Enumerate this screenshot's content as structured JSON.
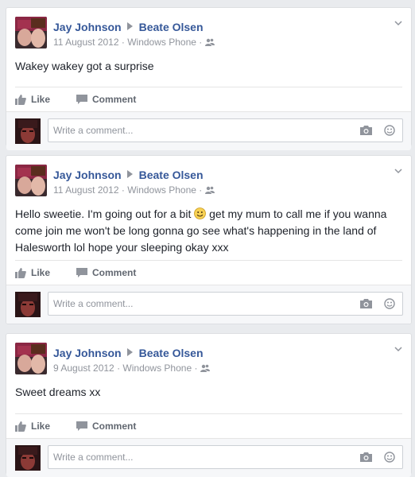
{
  "posts": [
    {
      "author": "Jay Johnson",
      "recipient": "Beate Olsen",
      "date": "11 August 2012",
      "source": "Windows Phone",
      "text": "Wakey wakey got a surprise",
      "like_label": "Like",
      "comment_label": "Comment",
      "comment_placeholder": "Write a comment..."
    },
    {
      "author": "Jay Johnson",
      "recipient": "Beate Olsen",
      "date": "11 August 2012",
      "source": "Windows Phone",
      "text_before_emoji": "Hello sweetie. I'm going out for a bit ",
      "text_after_emoji": " get my mum to call me if you wanna come join me won't be long gonna go see what's happening in the land of Halesworth lol hope your sleeping okay xxx",
      "like_label": "Like",
      "comment_label": "Comment",
      "comment_placeholder": "Write a comment..."
    },
    {
      "author": "Jay Johnson",
      "recipient": "Beate Olsen",
      "date": "9 August 2012",
      "source": "Windows Phone",
      "text": "Sweet dreams xx",
      "like_label": "Like",
      "comment_label": "Comment",
      "comment_placeholder": "Write a comment..."
    }
  ],
  "meta_separator": " · ",
  "icons": {
    "audience": "friends-icon",
    "options": "chevron-down-icon",
    "like": "thumbs-up-icon",
    "comment": "speech-bubble-icon",
    "camera": "camera-icon",
    "emoji": "smiley-icon"
  },
  "colors": {
    "link": "#365899",
    "meta": "#90949c",
    "background": "#e9ebee"
  }
}
